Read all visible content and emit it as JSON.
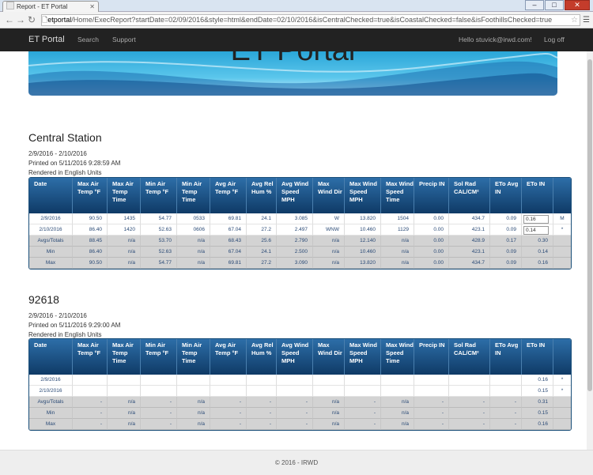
{
  "browser": {
    "tab_title": "Report - ET Portal",
    "url_host": "etportal",
    "url_path": "/Home/ExecReport?startDate=02/09/2016&style=html&endDate=02/10/2016&isCentralChecked=true&isCoastalChecked=false&isFoothillsChecked=true"
  },
  "navbar": {
    "brand": "ET Portal",
    "links": [
      "Search",
      "Support"
    ],
    "greeting": "Hello stuvick@irwd.com!",
    "logoff": "Log off"
  },
  "banner": {
    "title": "ET Portal"
  },
  "columns": [
    "Date",
    "Max Air Temp °F",
    "Max Air Temp Time",
    "Min Air Temp °F",
    "Min Air Temp Time",
    "Avg Air Temp °F",
    "Avg Rel Hum %",
    "Avg Wind Speed MPH",
    "Max Wind Dir",
    "Max Wind Speed MPH",
    "Max Wind Speed Time",
    "Precip IN",
    "Sol Rad CAL/CM²",
    "ETo Avg IN",
    "ETo IN"
  ],
  "sections": [
    {
      "title": "Central Station",
      "date_range": "2/9/2016 - 2/10/2016",
      "printed": "Printed on 5/11/2016 9:28:59 AM",
      "units": "Rendered in English Units",
      "rows": [
        {
          "cells": [
            "2/9/2016",
            "90.50",
            "1435",
            "54.77",
            "0533",
            "69.81",
            "24.1",
            "3.085",
            "W",
            "13.820",
            "1504",
            "0.00",
            "434.7",
            "0.09"
          ],
          "eto": "0.16",
          "suffix": "M"
        },
        {
          "cells": [
            "2/10/2016",
            "86.40",
            "1420",
            "52.63",
            "0606",
            "67.04",
            "27.2",
            "2.497",
            "WNW",
            "10.460",
            "1129",
            "0.00",
            "423.1",
            "0.09"
          ],
          "eto": "0.14",
          "suffix": "*"
        }
      ],
      "totals": [
        [
          "Avgs/Totals",
          "88.45",
          "n/a",
          "53.70",
          "n/a",
          "68.43",
          "25.6",
          "2.790",
          "n/a",
          "12.140",
          "n/a",
          "0.00",
          "428.9",
          "0.17",
          "0.30"
        ],
        [
          "Min",
          "86.40",
          "n/a",
          "52.63",
          "n/a",
          "67.04",
          "24.1",
          "2.500",
          "n/a",
          "10.460",
          "n/a",
          "0.00",
          "423.1",
          "0.09",
          "0.14"
        ],
        [
          "Max",
          "90.50",
          "n/a",
          "54.77",
          "n/a",
          "69.81",
          "27.2",
          "3.090",
          "n/a",
          "13.820",
          "n/a",
          "0.00",
          "434.7",
          "0.09",
          "0.16"
        ]
      ]
    },
    {
      "title": "92618",
      "date_range": "2/9/2016 - 2/10/2016",
      "printed": "Printed on 5/11/2016 9:29:00 AM",
      "units": "Rendered in English Units",
      "rows": [
        {
          "cells": [
            "2/9/2016",
            "",
            "",
            "",
            "",
            "",
            "",
            "",
            "",
            "",
            "",
            "",
            "",
            "",
            "0.16"
          ],
          "suffix": "*"
        },
        {
          "cells": [
            "2/10/2016",
            "",
            "",
            "",
            "",
            "",
            "",
            "",
            "",
            "",
            "",
            "",
            "",
            "",
            "0.15"
          ],
          "suffix": "*"
        }
      ],
      "totals": [
        [
          "Avgs/Totals",
          "-",
          "n/a",
          "-",
          "n/a",
          "-",
          "-",
          "-",
          "n/a",
          "-",
          "n/a",
          "-",
          "-",
          "-",
          "0.31"
        ],
        [
          "Min",
          "-",
          "n/a",
          "-",
          "n/a",
          "-",
          "-",
          "-",
          "n/a",
          "-",
          "n/a",
          "-",
          "-",
          "-",
          "0.15"
        ],
        [
          "Max",
          "-",
          "n/a",
          "-",
          "n/a",
          "-",
          "-",
          "-",
          "n/a",
          "-",
          "n/a",
          "-",
          "-",
          "-",
          "0.16"
        ]
      ]
    }
  ],
  "footer": "© 2016 - IRWD"
}
